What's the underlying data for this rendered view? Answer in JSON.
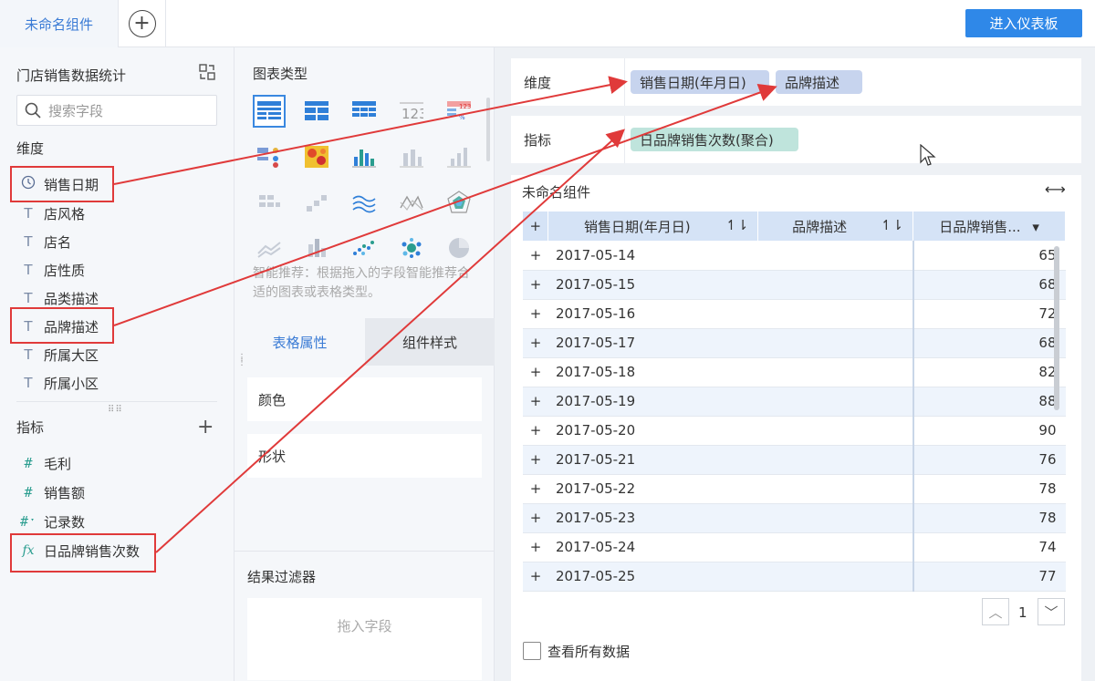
{
  "topbar": {
    "tab_label": "未命名组件",
    "add_tab": "+",
    "enter_dashboard": "进入仪表板"
  },
  "left": {
    "dataset_title": "门店销售数据统计",
    "search_placeholder": "搜索字段",
    "dimension_label": "维度",
    "dimensions": [
      "销售日期",
      "店风格",
      "店名",
      "店性质",
      "品类描述",
      "品牌描述",
      "所属大区",
      "所属小区"
    ],
    "metric_label": "指标",
    "metrics": [
      "毛利",
      "销售额",
      "记录数",
      "日品牌销售次数"
    ],
    "add_metric": "+"
  },
  "middle": {
    "chart_type_title": "图表类型",
    "smart_tip": "智能推荐：根据拖入的字段智能推荐合适的图表或表格类型。",
    "tab_table_props": "表格属性",
    "tab_widget_style": "组件样式",
    "prop_color": "颜色",
    "prop_shape": "形状",
    "filter_title": "结果过滤器",
    "filter_drop": "拖入字段"
  },
  "right": {
    "dimension_label": "维度",
    "dimension_pills": [
      "销售日期(年月日)",
      "品牌描述"
    ],
    "metric_label": "指标",
    "metric_pills": [
      "日品牌销售次数(聚合)"
    ],
    "widget_title": "未命名组件",
    "table": {
      "headers": [
        "销售日期(年月日)",
        "品牌描述",
        "日品牌销售..."
      ],
      "rows": [
        {
          "date": "2017-05-14",
          "value": "65"
        },
        {
          "date": "2017-05-15",
          "value": "68"
        },
        {
          "date": "2017-05-16",
          "value": "72"
        },
        {
          "date": "2017-05-17",
          "value": "68"
        },
        {
          "date": "2017-05-18",
          "value": "82"
        },
        {
          "date": "2017-05-19",
          "value": "88"
        },
        {
          "date": "2017-05-20",
          "value": "90"
        },
        {
          "date": "2017-05-21",
          "value": "76"
        },
        {
          "date": "2017-05-22",
          "value": "78"
        },
        {
          "date": "2017-05-23",
          "value": "78"
        },
        {
          "date": "2017-05-24",
          "value": "74"
        },
        {
          "date": "2017-05-25",
          "value": "77"
        }
      ]
    },
    "page_number": "1",
    "view_all_data": "查看所有数据"
  }
}
